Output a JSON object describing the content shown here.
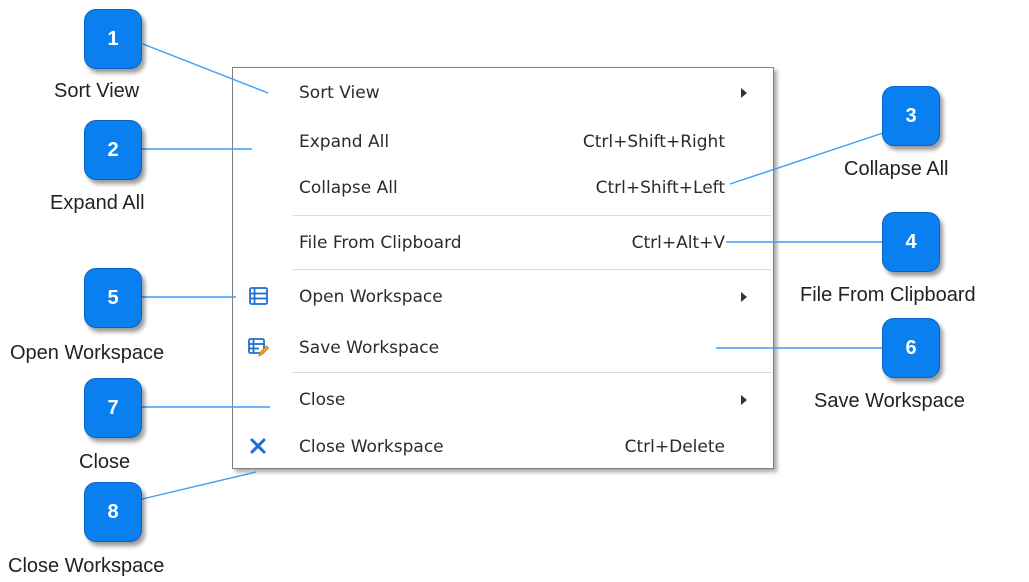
{
  "menu": {
    "items": [
      {
        "label": "Sort View",
        "shortcut": "",
        "submenu": true,
        "icon": ""
      },
      {
        "label": "Expand All",
        "shortcut": "Ctrl+Shift+Right",
        "submenu": false,
        "icon": ""
      },
      {
        "label": "Collapse All",
        "shortcut": "Ctrl+Shift+Left",
        "submenu": false,
        "icon": ""
      },
      {
        "label": "File From Clipboard",
        "shortcut": "Ctrl+Alt+V",
        "submenu": false,
        "icon": ""
      },
      {
        "label": "Open Workspace",
        "shortcut": "",
        "submenu": true,
        "icon": "workspace-list-icon"
      },
      {
        "label": "Save Workspace",
        "shortcut": "",
        "submenu": false,
        "icon": "save-workspace-icon"
      },
      {
        "label": "Close",
        "shortcut": "",
        "submenu": true,
        "icon": ""
      },
      {
        "label": "Close Workspace",
        "shortcut": "Ctrl+Delete",
        "submenu": false,
        "icon": "close-x-icon"
      }
    ]
  },
  "callouts": [
    {
      "number": "1",
      "label": "Sort View"
    },
    {
      "number": "2",
      "label": "Expand All"
    },
    {
      "number": "3",
      "label": "Collapse All"
    },
    {
      "number": "4",
      "label": "File From Clipboard"
    },
    {
      "number": "5",
      "label": "Open Workspace"
    },
    {
      "number": "6",
      "label": "Save Workspace"
    },
    {
      "number": "7",
      "label": "Close"
    },
    {
      "number": "8",
      "label": "Close Workspace"
    }
  ],
  "colors": {
    "callout_fill": "#0a80f0",
    "leader_line": "#3d9ef5",
    "menu_border": "#7f7f7f",
    "icon_blue": "#1f6fd0",
    "icon_orange": "#f0a030"
  }
}
